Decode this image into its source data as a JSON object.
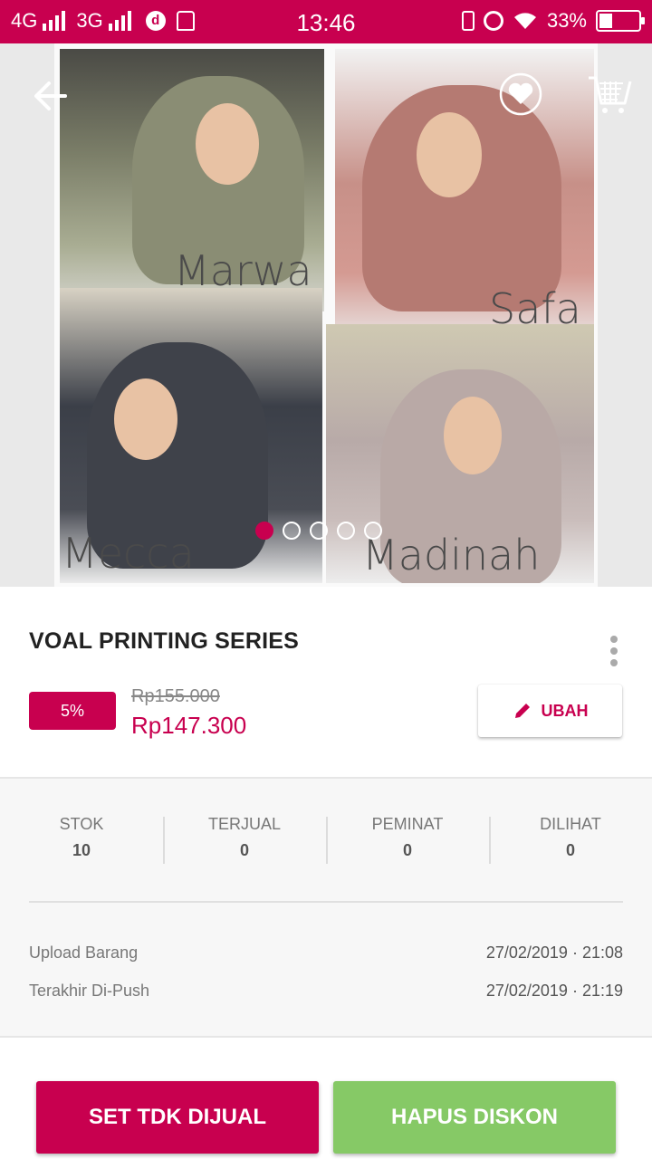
{
  "status_bar": {
    "network_1": "4G",
    "network_2": "3G",
    "time": "13:46",
    "battery": "33%",
    "battery_level": 0.33
  },
  "product_images": {
    "captions": [
      "Marwa",
      "Safa",
      "Mecca",
      "Madinah"
    ],
    "slide_count": 5,
    "active_slide": 1
  },
  "product": {
    "title": "VOAL PRINTING SERIES",
    "discount": "5%",
    "original_price": "Rp155.000",
    "price": "Rp147.300",
    "edit_label": "UBAH"
  },
  "stats": [
    {
      "label": "STOK",
      "value": "10"
    },
    {
      "label": "TERJUAL",
      "value": "0"
    },
    {
      "label": "PEMINAT",
      "value": "0"
    },
    {
      "label": "DILIHAT",
      "value": "0"
    }
  ],
  "meta": {
    "upload_label": "Upload Barang",
    "upload_value": "27/02/2019 · 21:08",
    "push_label": "Terakhir Di-Push",
    "push_value": "27/02/2019 · 21:19"
  },
  "actions": {
    "unsell_label": "SET TDK DIJUAL",
    "remove_discount_label": "HAPUS DISKON"
  },
  "colors": {
    "brand": "#c8004f",
    "success": "#86c966"
  }
}
